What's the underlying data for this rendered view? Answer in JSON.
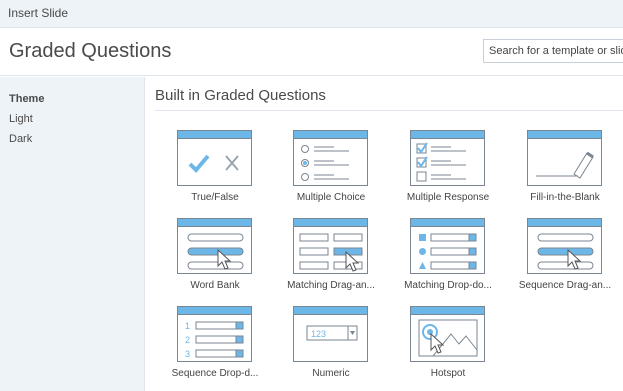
{
  "window_title": "Insert Slide",
  "header": {
    "title": "Graded Questions",
    "search_placeholder": "Search for a template or slide"
  },
  "sidebar": {
    "section_title": "Theme",
    "items": [
      "Light",
      "Dark"
    ]
  },
  "main": {
    "section_title": "Built in Graded Questions",
    "tiles": [
      {
        "label": "True/False",
        "icon": "true-false-icon"
      },
      {
        "label": "Multiple Choice",
        "icon": "multiple-choice-icon"
      },
      {
        "label": "Multiple Response",
        "icon": "multiple-response-icon"
      },
      {
        "label": "Fill-in-the-Blank",
        "icon": "fill-in-the-blank-icon"
      },
      {
        "label": "Word Bank",
        "icon": "word-bank-icon"
      },
      {
        "label": "Matching  Drag-an...",
        "icon": "matching-drag-icon"
      },
      {
        "label": "Matching  Drop-do...",
        "icon": "matching-dropdown-icon"
      },
      {
        "label": "Sequence  Drag-an...",
        "icon": "sequence-drag-icon"
      },
      {
        "label": "Sequence  Drop-d...",
        "icon": "sequence-dropdown-icon"
      },
      {
        "label": "Numeric",
        "icon": "numeric-icon",
        "field_value": "123"
      },
      {
        "label": "Hotspot",
        "icon": "hotspot-icon"
      }
    ]
  },
  "colors": {
    "accent": "#6db6e8",
    "outline": "#7a8692",
    "sidebar_bg": "#eef3f7"
  }
}
